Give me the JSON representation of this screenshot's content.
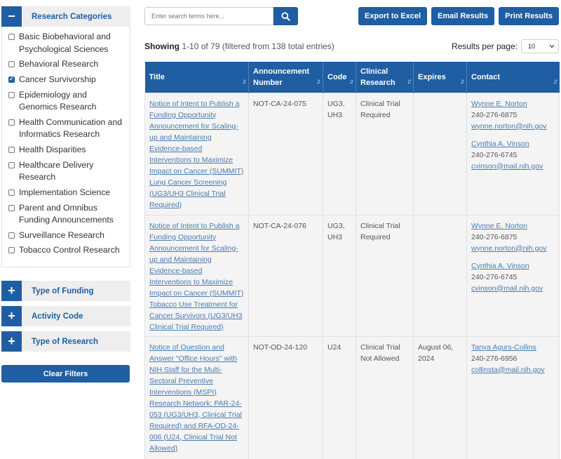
{
  "sidebar": {
    "research_categories_label": "Research Categories",
    "categories": [
      {
        "label": "Basic Biobehavioral and Psychological Sciences",
        "checked": false
      },
      {
        "label": "Behavioral Research",
        "checked": false
      },
      {
        "label": "Cancer Survivorship",
        "checked": true
      },
      {
        "label": "Epidemiology and Genomics Research",
        "checked": false
      },
      {
        "label": "Health Communication and Informatics Research",
        "checked": false
      },
      {
        "label": "Health Disparities",
        "checked": false
      },
      {
        "label": "Healthcare Delivery Research",
        "checked": false
      },
      {
        "label": "Implementation Science",
        "checked": false
      },
      {
        "label": "Parent and Omnibus Funding Announcements",
        "checked": false
      },
      {
        "label": "Surveillance Research",
        "checked": false
      },
      {
        "label": "Tobacco Control Research",
        "checked": false
      }
    ],
    "type_of_funding_label": "Type of Funding",
    "activity_code_label": "Activity Code",
    "type_of_research_label": "Type of Research",
    "clear_filters_label": "Clear Filters"
  },
  "search": {
    "placeholder": "Enter search terms here..."
  },
  "toolbar": {
    "export_label": "Export to Excel",
    "email_label": "Email Results",
    "print_label": "Print Results"
  },
  "summary": {
    "showing_label": "Showing",
    "showing_rest": "1-10 of 79 (filtered from 138 total entries)",
    "rpp_label": "Results per page:",
    "rpp_value": "10"
  },
  "table": {
    "headers": {
      "title": "Title",
      "announcement_1": "Announcement",
      "announcement_2": "Number",
      "code": "Code",
      "clinical_1": "Clinical",
      "clinical_2": "Research",
      "expires": "Expires",
      "contact": "Contact"
    },
    "rows": [
      {
        "title": "Notice of Intent to Publish a Funding Opportunity Announcement for Scaling-up and Maintaining Evidence-based Interventions to Maximize Impact on Cancer (SUMMIT) Lung Cancer Screening (UG3/UH3 Clinical Trial Required)",
        "number": "NOT-CA-24-075",
        "code": "UG3, UH3",
        "clinical": "Clinical Trial Required",
        "expires": "",
        "contacts": [
          {
            "name": "Wynne E. Norton",
            "phone": "240-276-6875",
            "email": "wynne.norton@nih.gov"
          },
          {
            "name": "Cynthia A. Vinson",
            "phone": "240-276-6745",
            "email": "cvinson@mail.nih.gov"
          }
        ]
      },
      {
        "title": "Notice of Intent to Publish a Funding Opportunity Announcement for Scaling-up and Maintaining Evidence-based Interventions to Maximize Impact on Cancer (SUMMIT) Tobacco Use Treatment for Cancer Survivors (UG3/UH3 Clinical Trial Required)",
        "number": "NOT-CA-24-076",
        "code": "UG3, UH3",
        "clinical": "Clinical Trial Required",
        "expires": "",
        "contacts": [
          {
            "name": "Wynne E. Norton",
            "phone": "240-276-6875",
            "email": "wynne.norton@nih.gov"
          },
          {
            "name": "Cynthia A. Vinson",
            "phone": "240-276-6745",
            "email": "cvinson@mail.nih.gov"
          }
        ]
      },
      {
        "title": "Notice of Question and Answer \"Office Hours\" with NIH Staff for the Multi-Sectoral Preventive Interventions (MSPI) Research Network: PAR-24-053 (UG3/UH3, Clinical Trial Required) and RFA-OD-24-006 (U24, Clinical Trial Not Allowed)",
        "number": "NOT-OD-24-120",
        "code": "U24",
        "clinical": "Clinical Trial Not Allowed",
        "expires": "August 06, 2024",
        "contacts": [
          {
            "name": "Tanya Agurs-Collins",
            "phone": "240-276-6956",
            "email": "collinsta@mail.nih.gov"
          }
        ]
      }
    ]
  },
  "colors": {
    "primary": "#1f5ea3",
    "link": "#4a7bb0",
    "row_bg": "#f4f4f4"
  },
  "icons": [
    "minus-icon",
    "plus-icon",
    "search-icon",
    "sort-icon",
    "checkbox-icon",
    "dropdown-arrow-icon"
  ]
}
